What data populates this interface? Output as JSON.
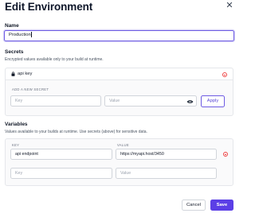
{
  "dialog": {
    "title": "Edit Environment",
    "close_icon": "close-icon"
  },
  "name": {
    "label": "Name",
    "value": "Production"
  },
  "secrets": {
    "label": "Secrets",
    "help": "Encrypted values available only to your build at runtime.",
    "items": [
      {
        "name": "api key",
        "icon": "lock-icon",
        "remove_icon": "remove-circle-icon"
      }
    ],
    "add_label": "ADD A NEW SECRET",
    "key_placeholder": "Key",
    "value_placeholder": "Value",
    "visibility_icon": "eye-icon",
    "apply_label": "Apply"
  },
  "variables": {
    "label": "Variables",
    "help": "Values available to your builds at runtime. Use secrets (above) for sensitive data.",
    "key_header": "KEY",
    "value_header": "VALUE",
    "rows": [
      {
        "key": "api endpoint",
        "value": "https://myapi.host/3450"
      }
    ],
    "key_placeholder": "Key",
    "value_placeholder": "Value"
  },
  "footer": {
    "cancel_label": "Cancel",
    "save_label": "Save"
  },
  "colors": {
    "accent": "#5b3fe6",
    "danger": "#ef4444"
  }
}
